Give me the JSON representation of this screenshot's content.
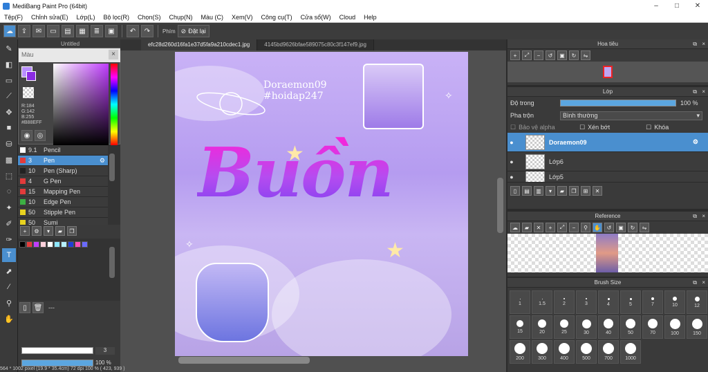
{
  "title": "MediBang Paint Pro (64bit)",
  "window_controls": [
    "–",
    "□",
    "✕"
  ],
  "menu": [
    "Tệp(F)",
    "Chỉnh sửa(E)",
    "Lớp(L)",
    "Bộ lọc(R)",
    "Chọn(S)",
    "Chụp(N)",
    "Màu (C)",
    "Xem(V)",
    "Công cụ(T)",
    "Cửa sổ(W)",
    "Cloud",
    "Help"
  ],
  "toolbar": {
    "phim_label": "Phím",
    "reset_label": "Đặt lại"
  },
  "tabs": [
    "Untitled",
    "efc28d260d16fa1e37d5fa9a210cdec1.jpg",
    "4145bd9626bfae589075c80c3f147ef9.jpg"
  ],
  "color_panel": {
    "title": "Màu",
    "r": "R:184",
    "g": "G:142",
    "b": "B:255",
    "hex": "#B88EFF"
  },
  "brushes": [
    {
      "size": "9.1",
      "name": "Pencil",
      "color": "#ffffff"
    },
    {
      "size": "3",
      "name": "Pen",
      "color": "#e23b3b",
      "selected": true
    },
    {
      "size": "10",
      "name": "Pen (Sharp)",
      "color": "#222222"
    },
    {
      "size": "4",
      "name": "G Pen",
      "color": "#e23b3b"
    },
    {
      "size": "15",
      "name": "Mapping Pen",
      "color": "#e23b3b"
    },
    {
      "size": "10",
      "name": "Edge Pen",
      "color": "#3cb043"
    },
    {
      "size": "50",
      "name": "Stipple Pen",
      "color": "#e8d21f"
    },
    {
      "size": "50",
      "name": "Sumi",
      "color": "#e8d21f"
    }
  ],
  "palette_colors": [
    "#000000",
    "#e23b3b",
    "#c03cff",
    "#ffd1dc",
    "#ffffff",
    "#8ee8ff",
    "#b6f0ff",
    "#1f3ed6",
    "#ff4fb8",
    "#6a6aff"
  ],
  "brush_size_value": "3",
  "opacity_value": "100 %",
  "layer_panel_text": "---",
  "artwork": {
    "watermark_line1": "Doraemon09",
    "watermark_line2": "#hoidap247",
    "main_text": "Buồn"
  },
  "status": "564 * 1002 pixel   (19.9 * 35.4cm)   72 dpi   100 %   ( 423, 939 )",
  "navigator": {
    "title": "Hoa tiêu"
  },
  "layers": {
    "title": "Lớp",
    "opacity_label": "Độ trong",
    "opacity_value": "100 %",
    "blend_label": "Pha trộn",
    "blend_value": "Bình thường",
    "protect_alpha": "Bảo vệ alpha",
    "clipping": "Xén bớt",
    "lock": "Khóa",
    "items": [
      {
        "name": "Doraemon09",
        "selected": true
      },
      {
        "name": "Lớp6"
      },
      {
        "name": "Lớp5"
      }
    ]
  },
  "reference": {
    "title": "Reference"
  },
  "brush_size": {
    "title": "Brush Size",
    "sizes": [
      "1",
      "1.5",
      "2",
      "3",
      "4",
      "5",
      "7",
      "10",
      "12",
      "15",
      "20",
      "25",
      "30",
      "40",
      "50",
      "70",
      "100",
      "150",
      "200",
      "300",
      "400",
      "500",
      "700",
      "1000"
    ]
  }
}
